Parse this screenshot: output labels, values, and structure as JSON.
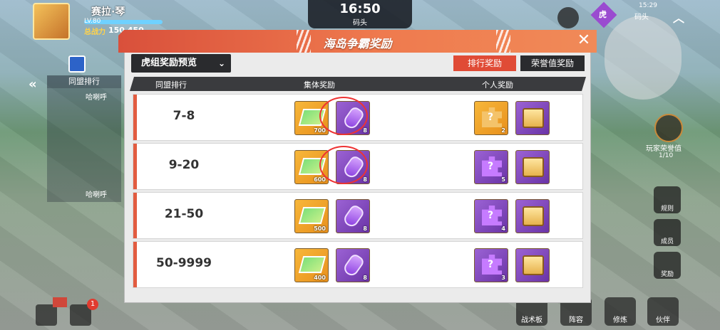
{
  "hud": {
    "player_name": "赛拉·琴",
    "player_level": "LV.80",
    "battle_label": "总战力",
    "battle_value": "150 450",
    "clock_time": "16:50",
    "clock_location": "码头",
    "minimap_time": "15:29",
    "minimap_location": "码头",
    "minimap_badge": "虎",
    "alliance_rank_title": "同盟排行",
    "side_name_1": "哈喇呼",
    "side_name_2": "哈喇呼",
    "honor_label": "玩家荣誉值",
    "honor_value": "1/10",
    "side_buttons": [
      "规则",
      "成员",
      "奖励"
    ],
    "bottom_buttons": [
      "战术板",
      "阵容",
      "修炼",
      "伙伴"
    ],
    "chat_badge": "1"
  },
  "modal": {
    "title": "海岛争霸奖励",
    "dropdown_label": "虎组奖励预览",
    "tabs": [
      "排行奖励",
      "荣誉值奖励"
    ],
    "columns": [
      "同盟排行",
      "集体奖励",
      "个人奖励"
    ],
    "rows": [
      {
        "rank": "7-8",
        "group": [
          {
            "type": "ticket",
            "count": "700"
          },
          {
            "type": "bottle",
            "count": "8"
          }
        ],
        "personal": [
          {
            "type": "puzzle-gold",
            "count": "2"
          },
          {
            "type": "chest",
            "count": ""
          }
        ]
      },
      {
        "rank": "9-20",
        "group": [
          {
            "type": "ticket",
            "count": "600"
          },
          {
            "type": "bottle",
            "count": "8"
          }
        ],
        "personal": [
          {
            "type": "puzzle-purple",
            "count": "5"
          },
          {
            "type": "chest",
            "count": ""
          }
        ]
      },
      {
        "rank": "21-50",
        "group": [
          {
            "type": "ticket",
            "count": "500"
          },
          {
            "type": "bottle",
            "count": "8"
          }
        ],
        "personal": [
          {
            "type": "puzzle-purple",
            "count": "4"
          },
          {
            "type": "chest",
            "count": ""
          }
        ]
      },
      {
        "rank": "50-9999",
        "group": [
          {
            "type": "ticket",
            "count": "400"
          },
          {
            "type": "bottle",
            "count": "8"
          }
        ],
        "personal": [
          {
            "type": "puzzle-purple",
            "count": "3"
          },
          {
            "type": "chest",
            "count": ""
          }
        ]
      }
    ]
  },
  "colors": {
    "accent": "#e04b36",
    "header_dark": "#2a2b2e",
    "gold_item": "#f7b73a",
    "purple_item": "#8a4ad0",
    "annotation_circle": "#e33333"
  }
}
